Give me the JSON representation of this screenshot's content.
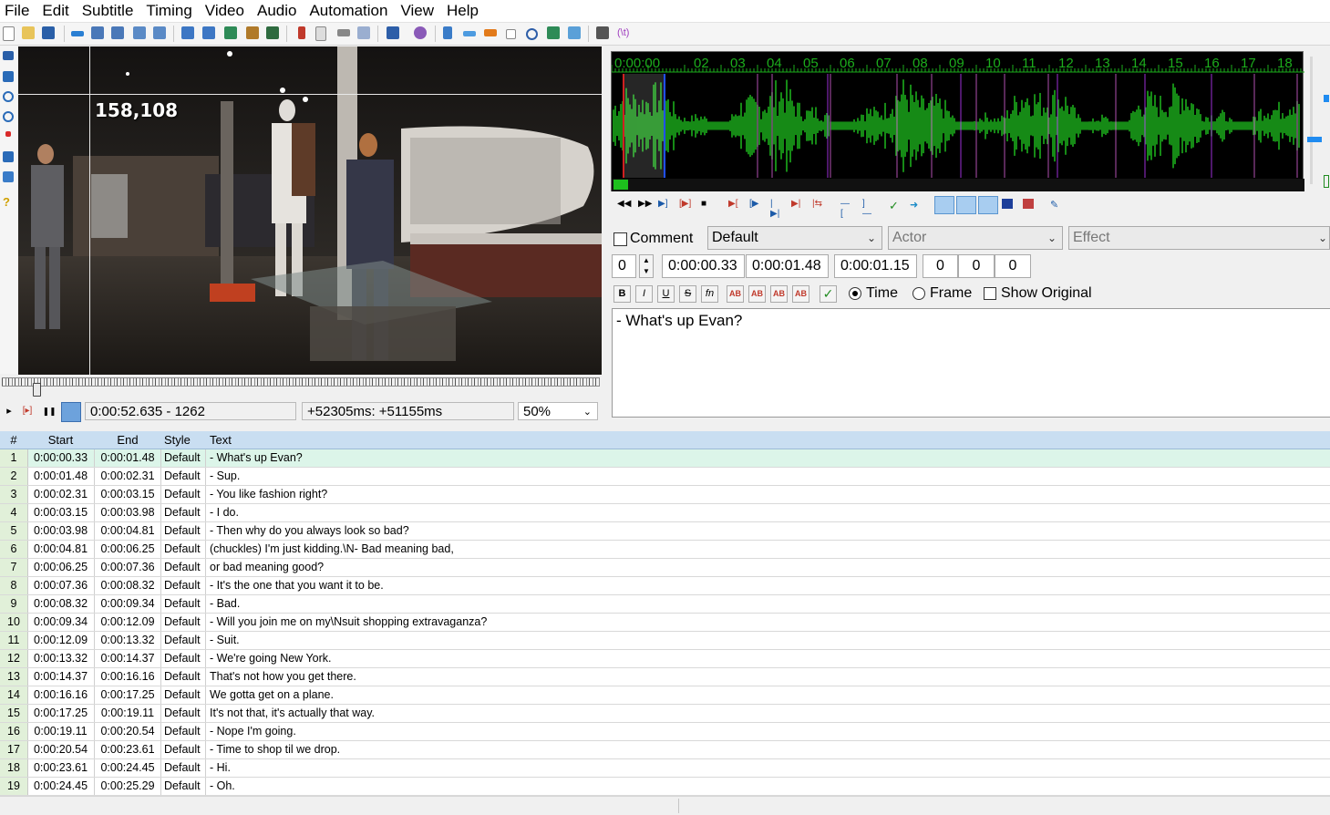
{
  "menu": [
    "File",
    "Edit",
    "Subtitle",
    "Timing",
    "Video",
    "Audio",
    "Automation",
    "View",
    "Help"
  ],
  "video": {
    "coordinate_readout": "158,108",
    "time_position": "0:00:52.635 - 1262",
    "time_offset": "+52305ms: +51155ms",
    "zoom": "50%",
    "seek_position": 0.052
  },
  "audio": {
    "timeline_labels": [
      "0:00:00",
      "02",
      "03",
      "04",
      "05",
      "06",
      "07",
      "08",
      "09",
      "10",
      "11",
      "12",
      "13",
      "14",
      "15",
      "16",
      "17",
      "18"
    ],
    "waveform_color": "#1cad1c"
  },
  "edit": {
    "comment_label": "Comment",
    "style_value": "Default",
    "actor_placeholder": "Actor",
    "effect_placeholder": "Effect",
    "layer": "0",
    "start_time": "0:00:00.33",
    "end_time": "0:00:01.48",
    "duration": "0:00:01.15",
    "margin_left": "0",
    "margin_right": "0",
    "margin_vertical": "0",
    "bold": "B",
    "italic": "I",
    "underline": "U",
    "strikeout": "S",
    "font": "fn",
    "color1": "AB",
    "color2": "AB",
    "color3": "AB",
    "color4": "AB",
    "time_label": "Time",
    "frame_label": "Frame",
    "show_original_label": "Show Original",
    "text": "- What's up Evan?"
  },
  "grid": {
    "headers": {
      "num": "#",
      "start": "Start",
      "end": "End",
      "style": "Style",
      "text": "Text"
    },
    "rows": [
      {
        "num": "1",
        "start": "0:00:00.33",
        "end": "0:00:01.48",
        "style": "Default",
        "text": "- What's up Evan?"
      },
      {
        "num": "2",
        "start": "0:00:01.48",
        "end": "0:00:02.31",
        "style": "Default",
        "text": "- Sup."
      },
      {
        "num": "3",
        "start": "0:00:02.31",
        "end": "0:00:03.15",
        "style": "Default",
        "text": "- You like fashion right?"
      },
      {
        "num": "4",
        "start": "0:00:03.15",
        "end": "0:00:03.98",
        "style": "Default",
        "text": "- I do."
      },
      {
        "num": "5",
        "start": "0:00:03.98",
        "end": "0:00:04.81",
        "style": "Default",
        "text": "- Then why do you always look so bad?"
      },
      {
        "num": "6",
        "start": "0:00:04.81",
        "end": "0:00:06.25",
        "style": "Default",
        "text": "(chuckles) I'm just kidding.\\N- Bad meaning bad,"
      },
      {
        "num": "7",
        "start": "0:00:06.25",
        "end": "0:00:07.36",
        "style": "Default",
        "text": "or bad meaning good?"
      },
      {
        "num": "8",
        "start": "0:00:07.36",
        "end": "0:00:08.32",
        "style": "Default",
        "text": "- It's the one that you want it to be."
      },
      {
        "num": "9",
        "start": "0:00:08.32",
        "end": "0:00:09.34",
        "style": "Default",
        "text": "- Bad."
      },
      {
        "num": "10",
        "start": "0:00:09.34",
        "end": "0:00:12.09",
        "style": "Default",
        "text": "- Will you join me on my\\Nsuit shopping extravaganza?"
      },
      {
        "num": "11",
        "start": "0:00:12.09",
        "end": "0:00:13.32",
        "style": "Default",
        "text": "- Suit."
      },
      {
        "num": "12",
        "start": "0:00:13.32",
        "end": "0:00:14.37",
        "style": "Default",
        "text": "- We're going New York."
      },
      {
        "num": "13",
        "start": "0:00:14.37",
        "end": "0:00:16.16",
        "style": "Default",
        "text": "That's not how you get there."
      },
      {
        "num": "14",
        "start": "0:00:16.16",
        "end": "0:00:17.25",
        "style": "Default",
        "text": "We gotta get on a plane."
      },
      {
        "num": "15",
        "start": "0:00:17.25",
        "end": "0:00:19.11",
        "style": "Default",
        "text": "It's not that, it's actually that way."
      },
      {
        "num": "16",
        "start": "0:00:19.11",
        "end": "0:00:20.54",
        "style": "Default",
        "text": "- Nope I'm going."
      },
      {
        "num": "17",
        "start": "0:00:20.54",
        "end": "0:00:23.61",
        "style": "Default",
        "text": "- Time to shop til we drop."
      },
      {
        "num": "18",
        "start": "0:00:23.61",
        "end": "0:00:24.45",
        "style": "Default",
        "text": "- Hi."
      },
      {
        "num": "19",
        "start": "0:00:24.45",
        "end": "0:00:25.29",
        "style": "Default",
        "text": "- Oh."
      }
    ]
  }
}
